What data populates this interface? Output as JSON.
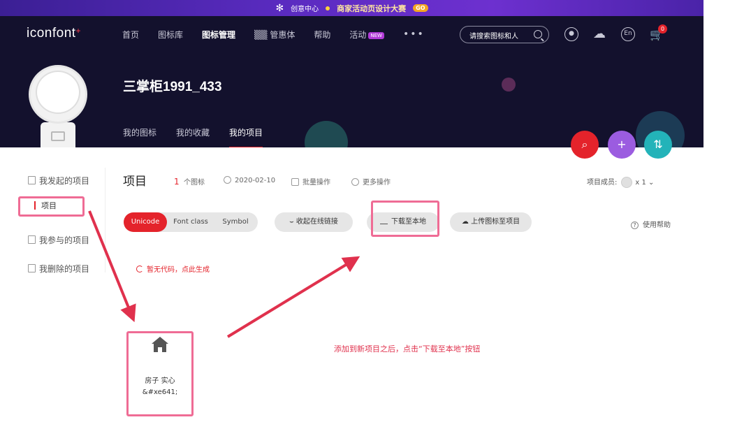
{
  "banner": {
    "left_text": "创意中心",
    "title": "商家活动页设计大赛",
    "go": "GO"
  },
  "header": {
    "logo": "iconfont",
    "logo_plus": "+",
    "nav": [
      "首页",
      "图标库",
      "图标管理",
      "▒▒ 管惠体",
      "帮助",
      "活动"
    ],
    "nav_new_badge": "NEW",
    "nav_more": "•••",
    "search_placeholder": "请搜索图标和人",
    "lang": "En",
    "cart_count": "0"
  },
  "profile": {
    "username": "三掌柜1991_433",
    "tabs": [
      "我的图标",
      "我的收藏",
      "我的项目"
    ]
  },
  "fab": {
    "search": "⌕",
    "add_folder": "+",
    "sort": "⇅"
  },
  "sidebar": {
    "items": [
      "我发起的项目",
      "我参与的项目",
      "我删除的项目"
    ],
    "active": "项目"
  },
  "project": {
    "title": "项目",
    "icon_count": "1",
    "icon_count_unit": "个图标",
    "date": "2020-02-10",
    "batch": "批量操作",
    "more": "更多操作",
    "members_label": "项目成员:",
    "members_count": "x 1",
    "tabs": [
      "Unicode",
      "Font class",
      "Symbol"
    ],
    "online_link": "收起在线链接",
    "download": "下载至本地",
    "upload": "上传图标至项目",
    "help": "使用帮助",
    "no_code": "暂无代码，点此生成"
  },
  "icon_card": {
    "name": "房子 实心",
    "code": "&#xe641;"
  },
  "annotation": {
    "note": "添加到新项目之后，点击“下载至本地”按钮"
  },
  "colors": {
    "accent": "#e4232b",
    "header_bg": "#13112d",
    "highlight": "#ef6c95"
  }
}
